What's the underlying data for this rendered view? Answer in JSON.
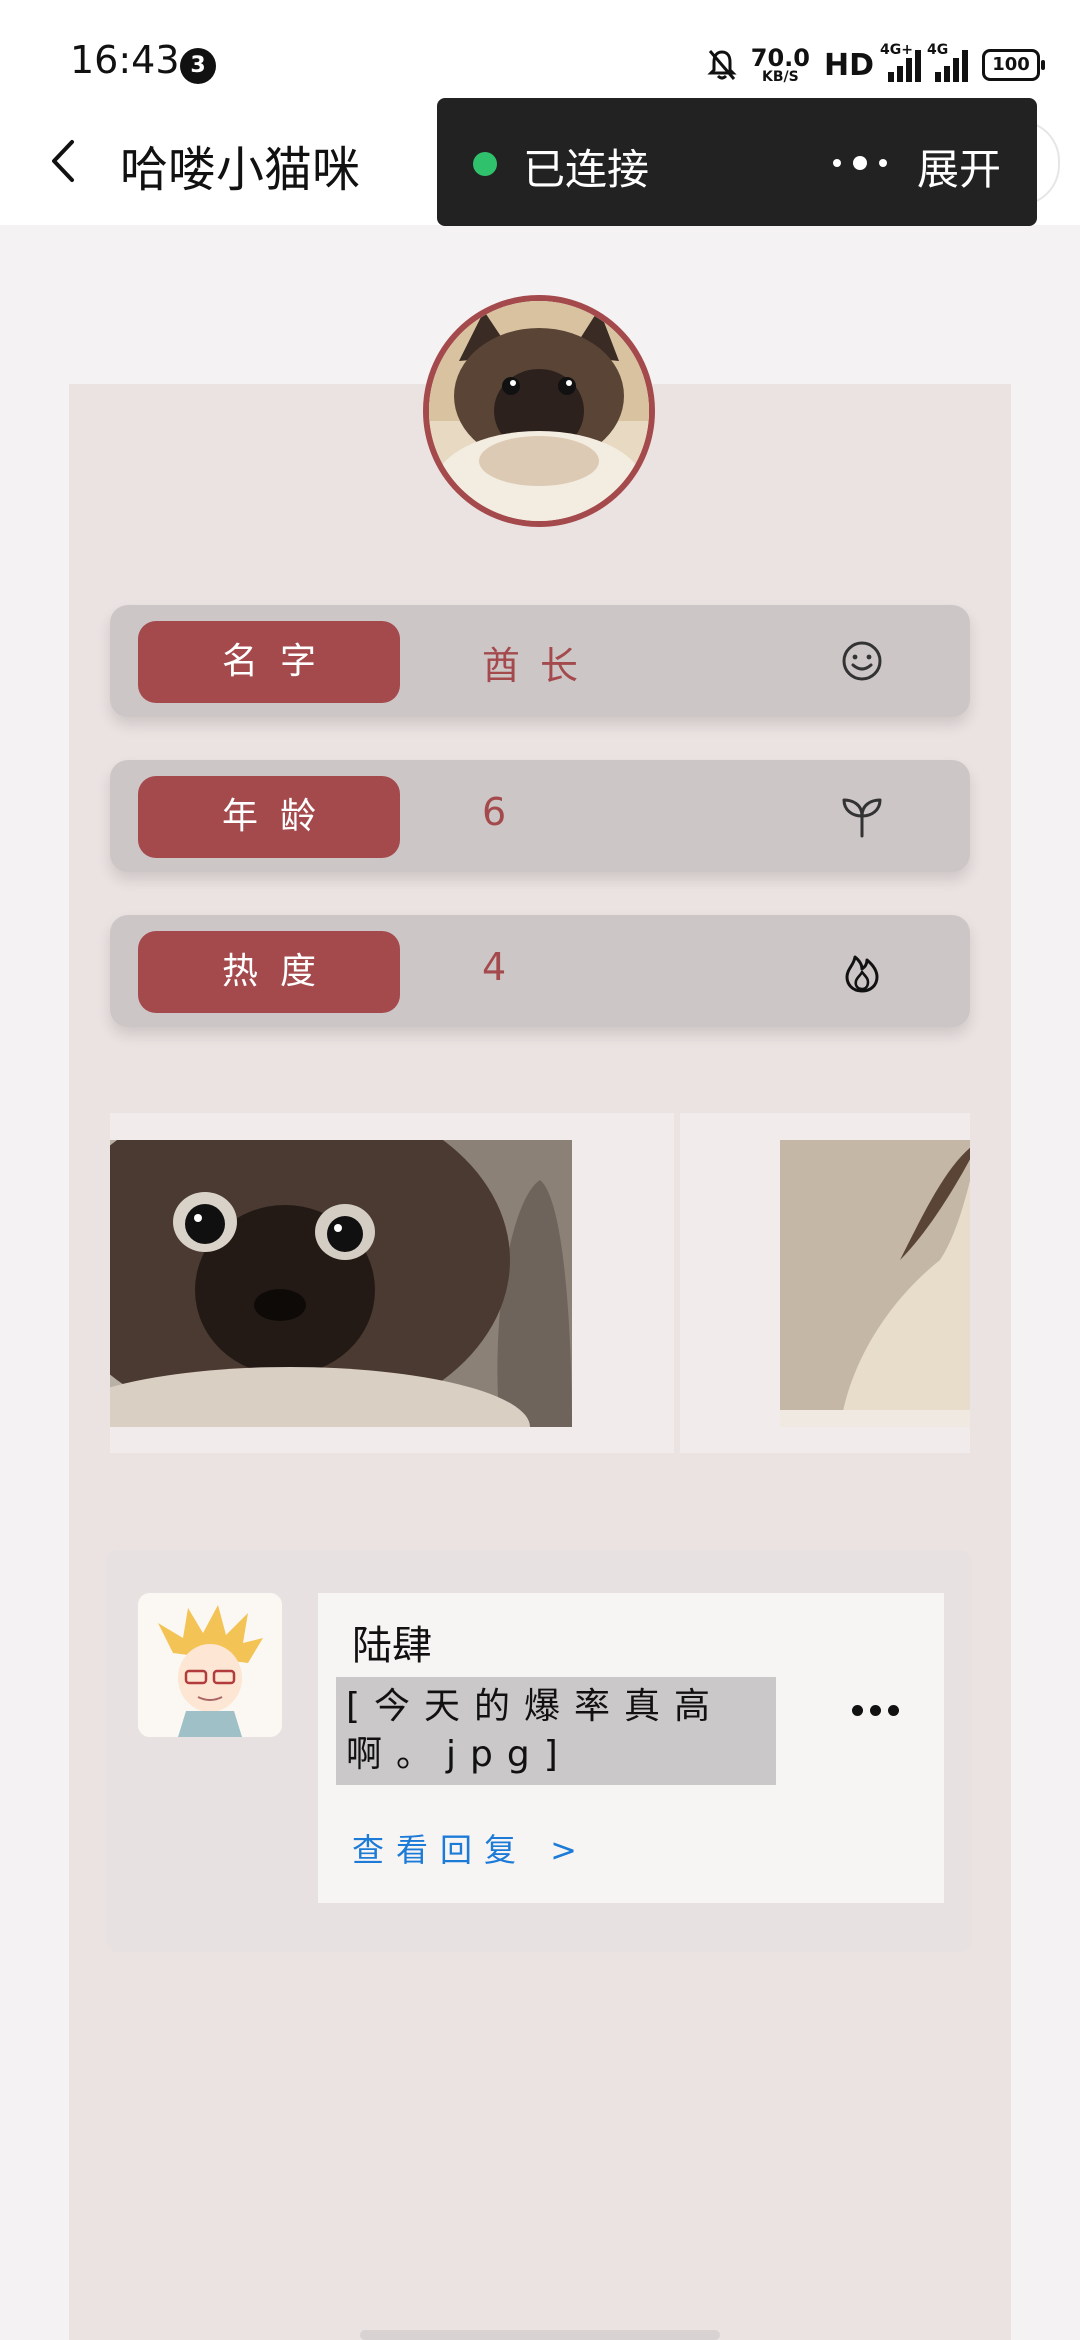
{
  "status_bar": {
    "time": "16:43",
    "notification_count": "3",
    "net_speed_value": "70.0",
    "net_speed_unit": "KB/S",
    "hd_label": "HD",
    "signal1_label": "4G+",
    "signal2_label": "4G",
    "battery": "100"
  },
  "app_bar": {
    "title": "哈喽小猫咪"
  },
  "toast": {
    "status_text": "已连接",
    "expand_label": "展开",
    "status_color": "#2fc16c"
  },
  "profile": {
    "fields": [
      {
        "label": "名字",
        "value": "酋长",
        "icon": "smile-icon"
      },
      {
        "label": "年龄",
        "value": "6",
        "icon": "sprout-icon"
      },
      {
        "label": "热度",
        "value": "4",
        "icon": "flame-icon"
      }
    ],
    "accent_color": "#a44a4d"
  },
  "comment": {
    "author": "陆肆",
    "text": "[今天的爆率真高啊。jpg]",
    "reply_link": "查看回复 >",
    "link_color": "#1d7bd8"
  }
}
